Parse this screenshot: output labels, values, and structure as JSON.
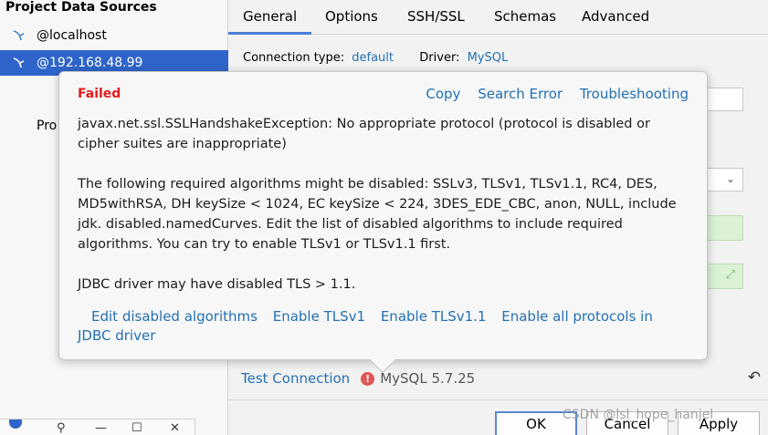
{
  "sidebar": {
    "title": "Project Data Sources",
    "items": [
      {
        "label": "@localhost",
        "selected": false
      },
      {
        "label": "@192.168.48.99",
        "selected": true
      }
    ],
    "partial_label": "Pro"
  },
  "tabs": [
    {
      "label": "General",
      "active": true
    },
    {
      "label": "Options",
      "active": false
    },
    {
      "label": "SSH/SSL",
      "active": false
    },
    {
      "label": "Schemas",
      "active": false
    },
    {
      "label": "Advanced",
      "active": false
    }
  ],
  "connection": {
    "type_label": "Connection type:",
    "type_value": "default",
    "driver_label": "Driver:",
    "driver_value": "MySQL"
  },
  "popup": {
    "status": "Failed",
    "actions": [
      "Copy",
      "Search Error",
      "Troubleshooting"
    ],
    "paragraphs": [
      "javax.net.ssl.SSLHandshakeException: No appropriate protocol (protocol is disabled or cipher suites are inappropriate)",
      "The following required algorithms might be disabled: SSLv3, TLSv1, TLSv1.1, RC4, DES, MD5withRSA, DH keySize < 1024, EC keySize < 224, 3DES_EDE_CBC, anon, NULL, include jdk. disabled.namedCurves. Edit the list of disabled algorithms to include required algorithms. You can try to enable TLSv1 or TLSv1.1 first.",
      "JDBC driver may have disabled TLS > 1.1."
    ],
    "fix_links": [
      "Edit disabled algorithms",
      "Enable TLSv1",
      "Enable TLSv1.1",
      "Enable all protocols in JDBC driver"
    ]
  },
  "test": {
    "link": "Test Connection",
    "error_glyph": "!",
    "version": "MySQL 5.7.25"
  },
  "buttons": {
    "ok": "OK",
    "cancel": "Cancel",
    "apply": "Apply"
  },
  "watermark": "CSDN @lsl_hope_hanjel",
  "colors": {
    "accent": "#2f65ca",
    "link": "#2470b3",
    "error": "#e31b1b"
  }
}
